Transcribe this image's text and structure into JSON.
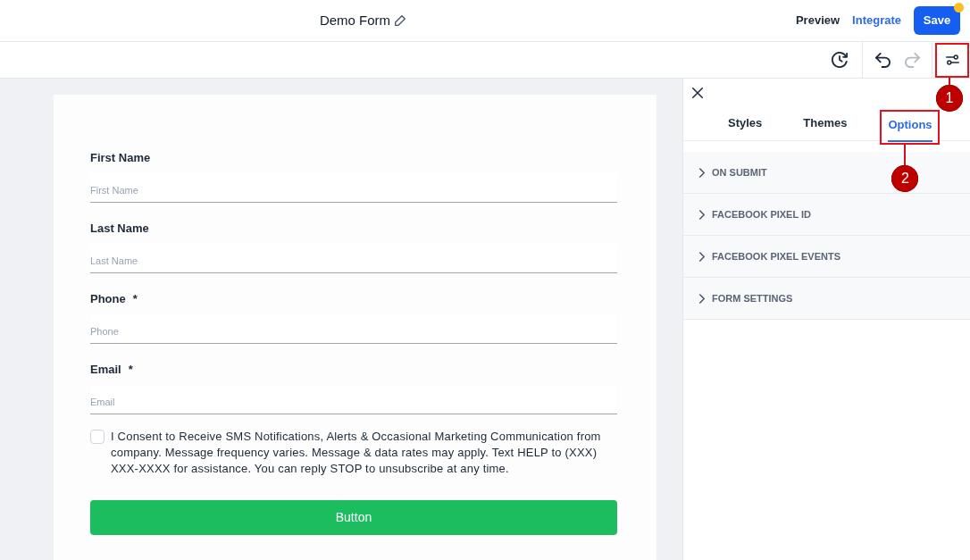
{
  "header": {
    "title": "Demo Form",
    "links": [
      {
        "label": "Preview",
        "kind": "plain"
      },
      {
        "label": "Integrate",
        "kind": "accent"
      }
    ],
    "save_button": {
      "label": "Save",
      "unsaved_dot": true
    }
  },
  "toolbar": {
    "groups": [
      [
        {
          "kind": "history",
          "disabled": false
        }
      ],
      [
        {
          "kind": "undo",
          "disabled": false
        },
        {
          "kind": "redo",
          "disabled": true
        }
      ],
      [
        {
          "kind": "settings",
          "disabled": false,
          "callout": "1"
        }
      ]
    ]
  },
  "form": {
    "fields": [
      {
        "label": "First Name",
        "placeholder": "First Name"
      },
      {
        "label": "Last Name",
        "placeholder": "Last Name"
      },
      {
        "label": "Phone",
        "required_mark": "*",
        "placeholder": "Phone"
      },
      {
        "label": "Email",
        "required_mark": "*",
        "placeholder": "Email"
      }
    ],
    "consent": {
      "checked": false,
      "text": "I Consent to Receive SMS Notifications, Alerts & Occasional Marketing Communication from company. Message frequency varies. Message & data rates may apply. Text HELP to (XXX) XXX-XXXX for assistance. You can reply STOP to unsubscribe at any time."
    },
    "submit_button": "Button"
  },
  "panel": {
    "tabs": [
      {
        "label": "Styles",
        "selected": false
      },
      {
        "label": "Themes",
        "selected": false
      },
      {
        "label": "Options",
        "selected": true,
        "callout": "2"
      }
    ],
    "sections": [
      {
        "title": "ON SUBMIT",
        "expanded": false
      },
      {
        "title": "FACEBOOK PIXEL ID",
        "expanded": false
      },
      {
        "title": "FACEBOOK PIXEL EVENTS",
        "expanded": false
      },
      {
        "title": "FORM SETTINGS",
        "expanded": false
      }
    ]
  }
}
